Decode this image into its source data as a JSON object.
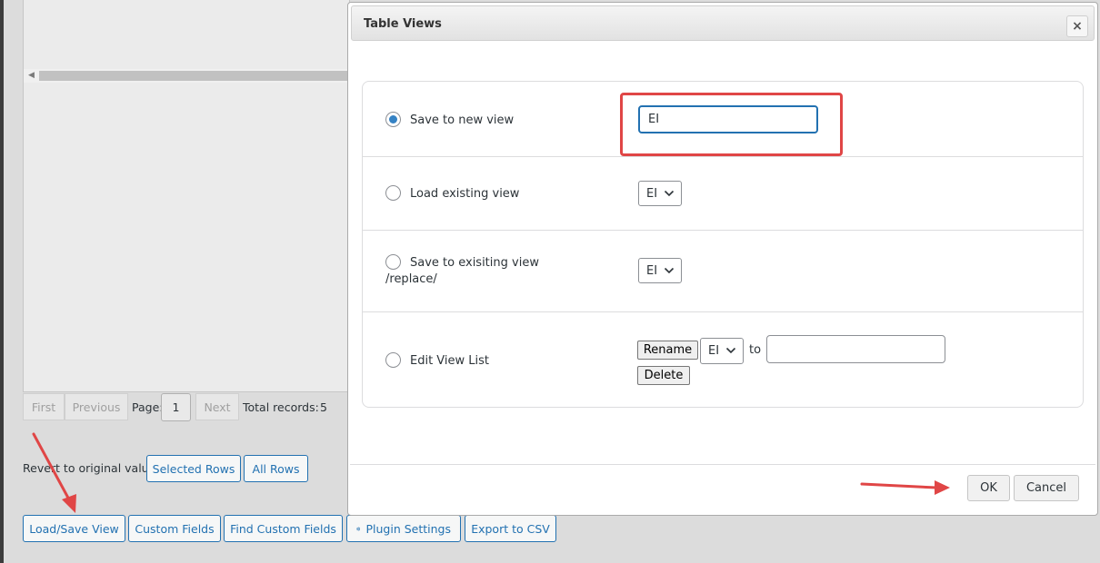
{
  "background": {
    "pager": {
      "first": "First",
      "previous": "Previous",
      "page_label": "Page:",
      "page_value": "1",
      "next": "Next",
      "total_label": "Total records:",
      "total_value": "5"
    },
    "revert": {
      "label": "Revert to original value",
      "selected_rows": "Selected Rows",
      "all_rows": "All Rows"
    },
    "toolbar": {
      "load_save_view": "Load/Save View",
      "custom_fields": "Custom Fields",
      "find_custom_fields": "Find Custom Fields",
      "plugin_settings": "Plugin Settings",
      "export_csv": "Export to CSV"
    }
  },
  "dialog": {
    "title": "Table Views",
    "close": "×",
    "options": {
      "save_new": {
        "label": "Save to new view",
        "value": "EI",
        "checked": true
      },
      "load_existing": {
        "label": "Load existing view",
        "selected": "EI"
      },
      "save_existing": {
        "label_line1": "Save to exisiting view",
        "label_line2": "/replace/",
        "selected": "EI"
      },
      "edit_list": {
        "label": "Edit View List",
        "rename": "Rename",
        "selected": "EI",
        "to": "to",
        "new_name": "",
        "delete": "Delete"
      }
    },
    "ok": "OK",
    "cancel": "Cancel"
  },
  "colors": {
    "accent": "#2271b1",
    "annotation": "#e04646"
  }
}
